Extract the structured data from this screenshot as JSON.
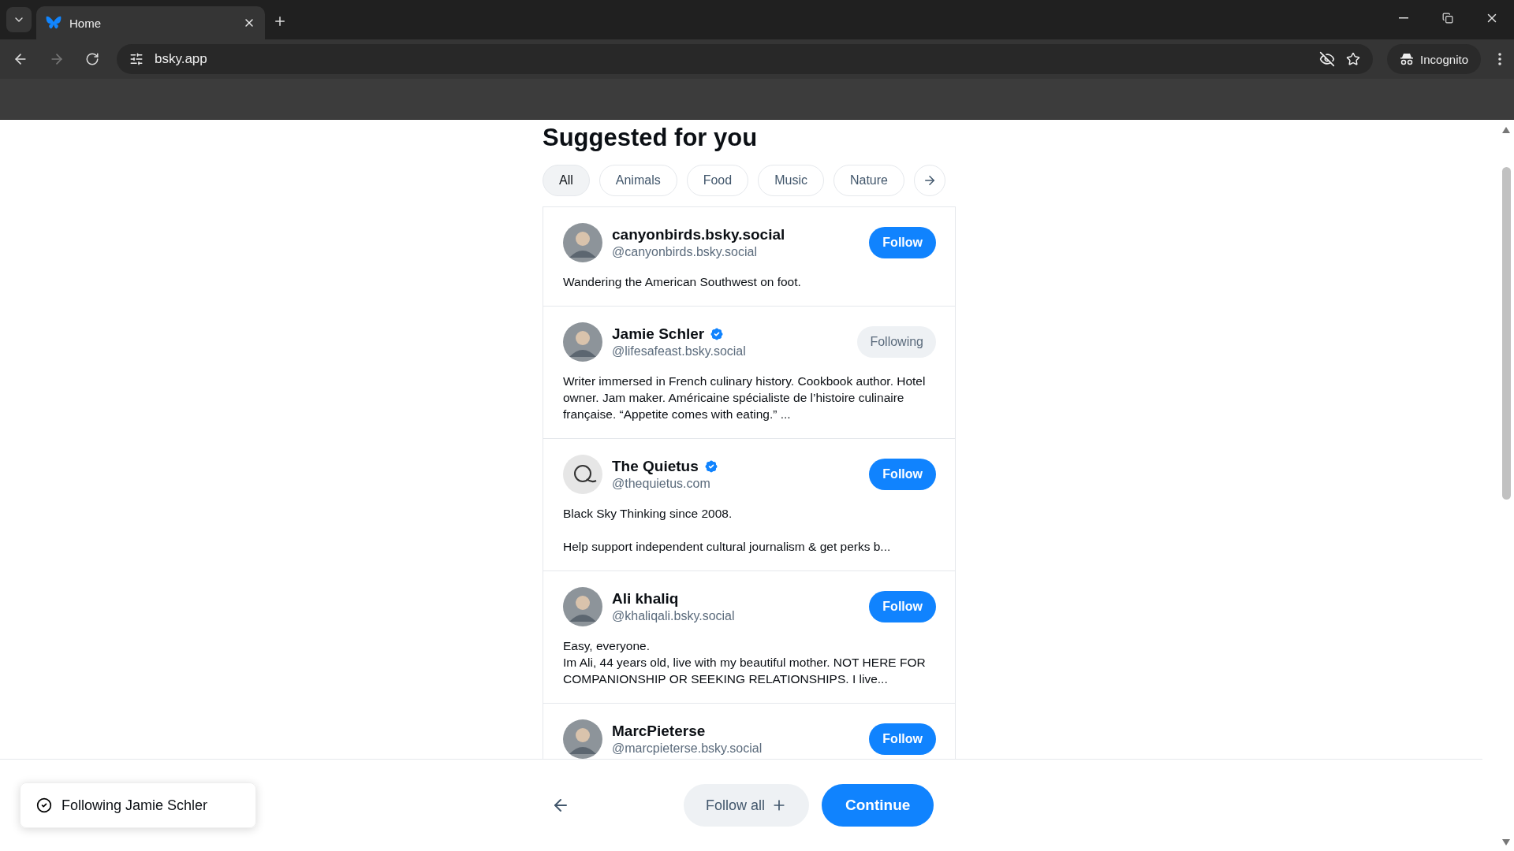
{
  "browser": {
    "tab_title": "Home",
    "url": "bsky.app",
    "profile_label": "Incognito"
  },
  "heading": "Suggested for you",
  "categories": [
    {
      "label": "All",
      "selected": true
    },
    {
      "label": "Animals",
      "selected": false
    },
    {
      "label": "Food",
      "selected": false
    },
    {
      "label": "Music",
      "selected": false
    },
    {
      "label": "Nature",
      "selected": false
    }
  ],
  "suggestions": [
    {
      "name": "canyonbirds.bsky.social",
      "handle": "@canyonbirds.bsky.social",
      "verified": false,
      "button": "Follow",
      "following": false,
      "bio": "Wandering the American Southwest on foot.",
      "kind": "person"
    },
    {
      "name": "Jamie Schler",
      "handle": "@lifesafeast.bsky.social",
      "verified": true,
      "button": "Following",
      "following": true,
      "bio": "Writer immersed in French culinary history. Cookbook author. Hotel owner. Jam maker. Américaine spécialiste de l’histoire culinaire française. “Appetite comes with eating.” ...",
      "kind": "person"
    },
    {
      "name": "The Quietus",
      "handle": "@thequietus.com",
      "verified": true,
      "button": "Follow",
      "following": false,
      "bio": "Black Sky Thinking since 2008.\n\nHelp support independent cultural journalism & get perks b...",
      "kind": "logo"
    },
    {
      "name": "Ali khaliq",
      "handle": "@khaliqali.bsky.social",
      "verified": false,
      "button": "Follow",
      "following": false,
      "bio": "Easy, everyone.\nIm Ali, 44 years old, live with my beautiful mother. NOT HERE FOR COMPANIONSHIP OR SEEKING RELATIONSHIPS. I live...",
      "kind": "person"
    },
    {
      "name": "MarcPieterse",
      "handle": "@marcpieterse.bsky.social",
      "verified": false,
      "button": "Follow",
      "following": false,
      "kind": "person"
    }
  ],
  "toast": "Following Jamie Schler",
  "footer": {
    "follow_all": "Follow all",
    "continue": "Continue"
  }
}
